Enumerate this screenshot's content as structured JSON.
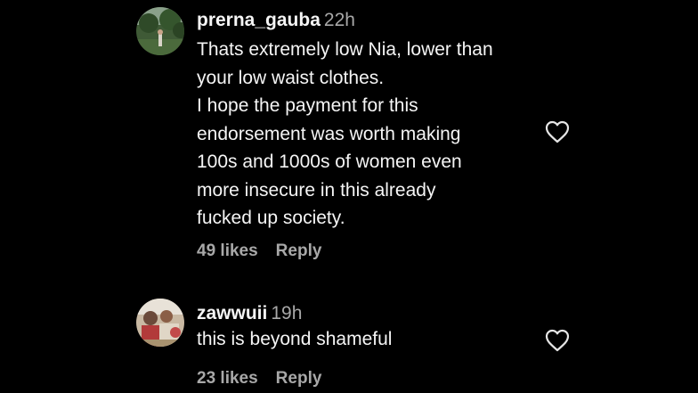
{
  "comments": [
    {
      "username": "prerna_gauba",
      "time": "22h",
      "lines": [
        "Thats extremely low Nia, lower than",
        "your low waist clothes.",
        "I hope the payment for this",
        "endorsement was worth making",
        "100s and 1000s of women even",
        "more insecure in this already",
        "fucked up society."
      ],
      "likes": "49 likes",
      "reply": "Reply",
      "avatar_icon": "avatar-photo-outdoor"
    },
    {
      "username": "zawwuii",
      "time": "19h",
      "lines": [
        "this is beyond shameful"
      ],
      "likes": "23 likes",
      "reply": "Reply",
      "avatar_icon": "avatar-photo-group"
    }
  ],
  "icons": {
    "like": "heart-outline-icon"
  },
  "colors": {
    "background": "#000000",
    "primary_text": "#f5f5f5",
    "secondary_text": "#a8a8a8"
  }
}
